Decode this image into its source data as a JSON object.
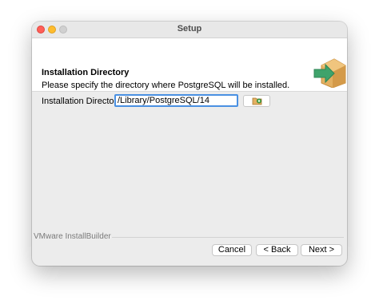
{
  "window": {
    "title": "Setup"
  },
  "header": {
    "title": "Installation Directory",
    "icon": "installer-box-arrow-icon"
  },
  "main": {
    "instructions": "Please specify the directory where PostgreSQL will be installed.",
    "directory_label": "Installation Directory",
    "directory_value": "/Library/PostgreSQL/14",
    "browse_icon": "folder-browse-icon"
  },
  "footer": {
    "brand": "VMware InstallBuilder",
    "cancel_label": "Cancel",
    "back_label": "< Back",
    "next_label": "Next >"
  },
  "colors": {
    "accent": "#4a90e2",
    "icon_arrow": "#3fa36b",
    "icon_box": "#e3b062"
  }
}
